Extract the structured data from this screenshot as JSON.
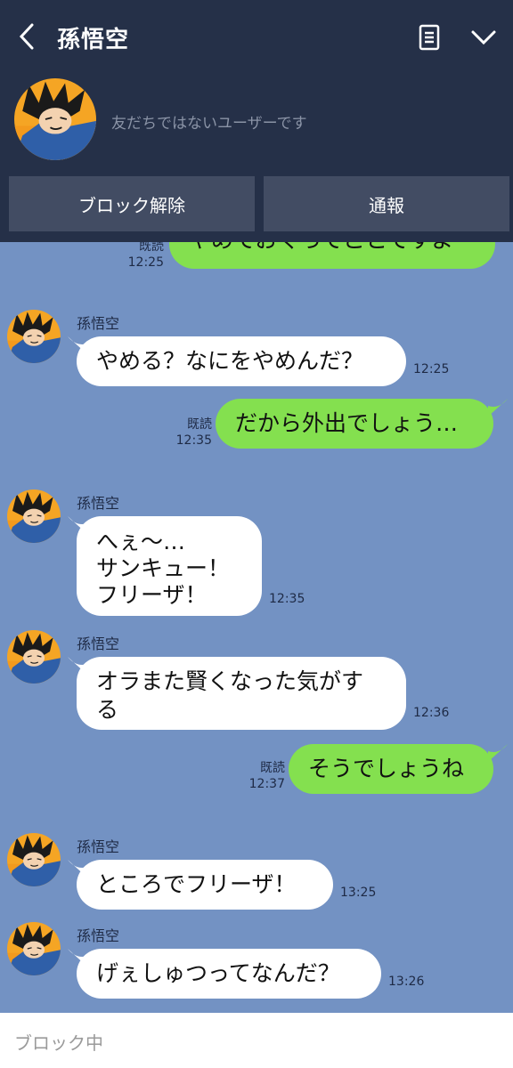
{
  "header": {
    "title": "孫悟空",
    "notice": "友だちではないユーザーです",
    "unblock_label": "ブロック解除",
    "report_label": "通報"
  },
  "messages": [
    {
      "side": "out",
      "text": "やめておくってことですよ",
      "read": "既読",
      "time": "12:25"
    },
    {
      "side": "in",
      "sender": "孫悟空",
      "text": "やめる？なにをやめんだ？",
      "time": "12:25"
    },
    {
      "side": "out",
      "text": "だから外出でしょう…",
      "read": "既読",
      "time": "12:35"
    },
    {
      "side": "in",
      "sender": "孫悟空",
      "text": "へぇ〜…\nサンキュー！\nフリーザ！",
      "time": "12:35"
    },
    {
      "side": "in",
      "sender": "孫悟空",
      "text": "オラまた賢くなった気がす\nる",
      "time": "12:36"
    },
    {
      "side": "out",
      "text": "そうでしょうね",
      "read": "既読",
      "time": "12:37"
    },
    {
      "side": "in",
      "sender": "孫悟空",
      "text": "ところでフリーザ！",
      "time": "13:25"
    },
    {
      "side": "in",
      "sender": "孫悟空",
      "text": "げぇしゅつってなんだ？",
      "time": "13:26"
    }
  ],
  "footer": {
    "blocked_label": "ブロック中"
  },
  "colors": {
    "header_bg": "#253048",
    "chat_bg": "#7392c3",
    "out_bubble": "#84e04f",
    "in_bubble": "#ffffff"
  },
  "icons": [
    "back-arrow-icon",
    "notes-icon",
    "chevron-down-icon"
  ]
}
